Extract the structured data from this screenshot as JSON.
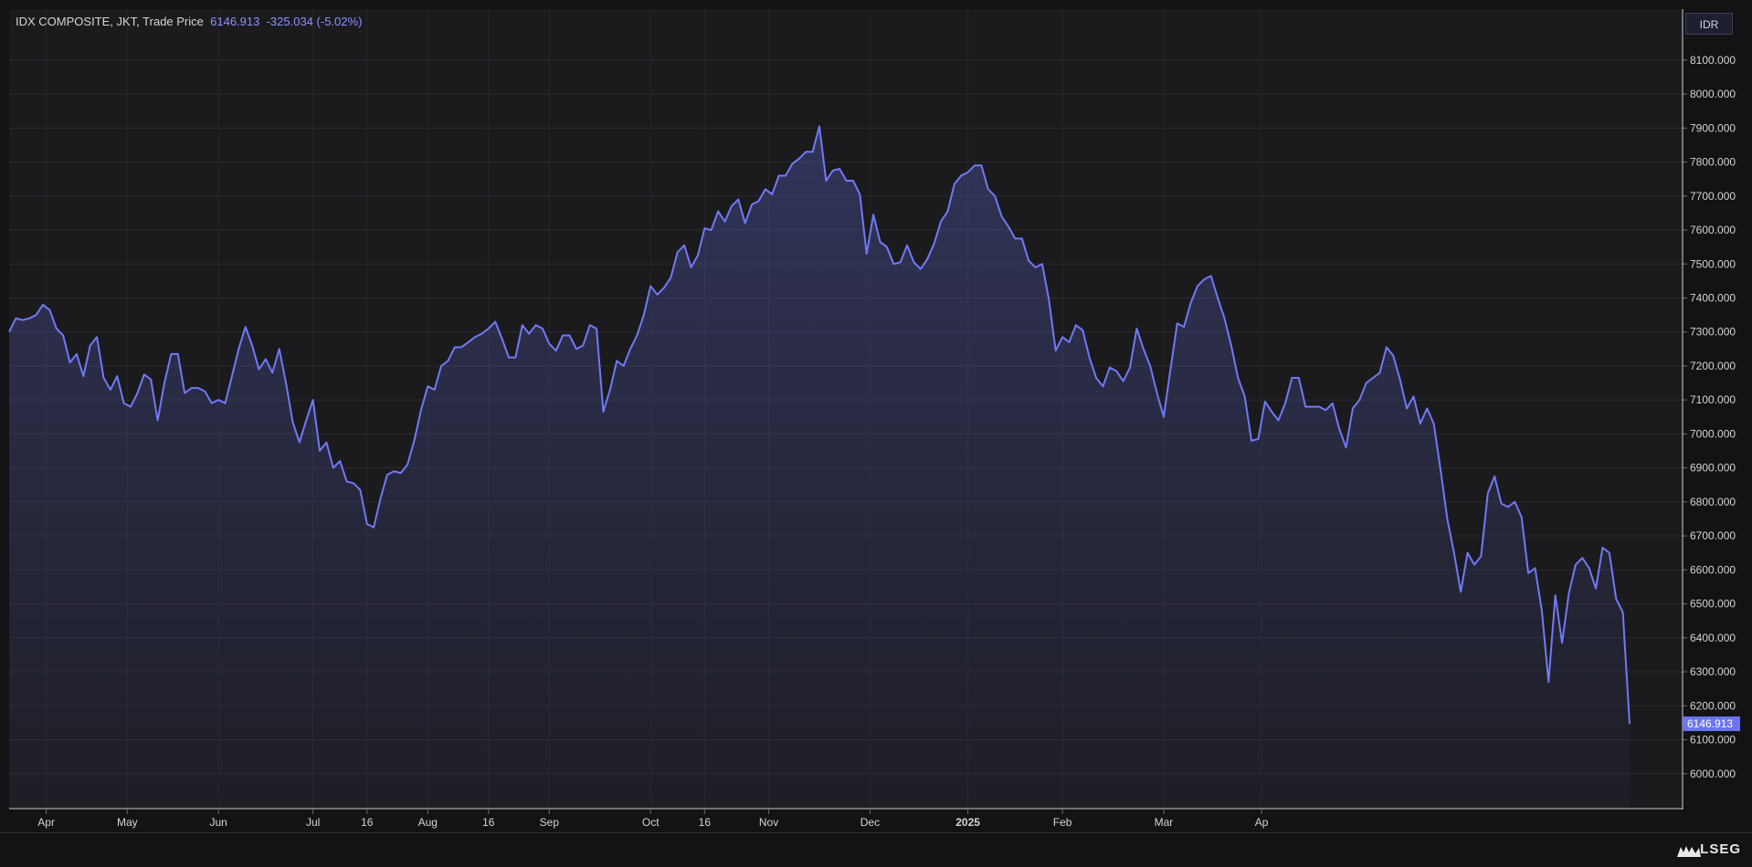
{
  "chart_data": {
    "type": "area",
    "title": "IDX COMPOSITE, JKT, Trade Price",
    "last_value": "6146.913",
    "change": "-325.034",
    "change_pct": "(-5.02%)",
    "currency": "IDR",
    "brand": "LSEG",
    "ylim": [
      5900,
      8250
    ],
    "yticks": [
      "6000.000",
      "6100.000",
      "6200.000",
      "6300.000",
      "6400.000",
      "6500.000",
      "6600.000",
      "6700.000",
      "6800.000",
      "6900.000",
      "7000.000",
      "7100.000",
      "7200.000",
      "7300.000",
      "7400.000",
      "7500.000",
      "7600.000",
      "7700.000",
      "7800.000",
      "7900.000",
      "8000.000",
      "8100.000"
    ],
    "xticks": [
      {
        "label": "Apr",
        "t": 5.5
      },
      {
        "label": "May",
        "t": 17.5
      },
      {
        "label": "Jun",
        "t": 31
      },
      {
        "label": "Jul",
        "t": 45
      },
      {
        "label": "16",
        "t": 53
      },
      {
        "label": "Aug",
        "t": 62
      },
      {
        "label": "16",
        "t": 71
      },
      {
        "label": "Sep",
        "t": 80
      },
      {
        "label": "Oct",
        "t": 95
      },
      {
        "label": "16",
        "t": 103
      },
      {
        "label": "Nov",
        "t": 112.5
      },
      {
        "label": "Dec",
        "t": 127.5
      },
      {
        "label": "2025",
        "t": 142
      },
      {
        "label": "Feb",
        "t": 156
      },
      {
        "label": "Mar",
        "t": 171
      },
      {
        "label": "Ap",
        "t": 185.5
      }
    ],
    "series": [
      {
        "values": [
          7300,
          7340,
          7335,
          7340,
          7350,
          7380,
          7365,
          7310,
          7290,
          7210,
          7235,
          7170,
          7260,
          7285,
          7165,
          7130,
          7170,
          7090,
          7080,
          7120,
          7175,
          7160,
          7040,
          7150,
          7235,
          7235,
          7120,
          7135,
          7135,
          7125,
          7090,
          7100,
          7090,
          7170,
          7250,
          7315,
          7260,
          7190,
          7220,
          7180,
          7250,
          7150,
          7035,
          6975,
          7040,
          7100,
          6950,
          6975,
          6900,
          6920,
          6860,
          6855,
          6835,
          6735,
          6725,
          6810,
          6880,
          6890,
          6885,
          6910,
          6980,
          7070,
          7140,
          7130,
          7200,
          7215,
          7255,
          7255,
          7270,
          7285,
          7295,
          7310,
          7330,
          7280,
          7225,
          7225,
          7320,
          7295,
          7320,
          7310,
          7265,
          7245,
          7290,
          7290,
          7250,
          7260,
          7320,
          7310,
          7065,
          7130,
          7215,
          7200,
          7250,
          7290,
          7350,
          7435,
          7410,
          7430,
          7460,
          7535,
          7555,
          7490,
          7525,
          7605,
          7600,
          7655,
          7625,
          7670,
          7690,
          7620,
          7675,
          7685,
          7720,
          7705,
          7760,
          7760,
          7795,
          7810,
          7830,
          7830,
          7905,
          7745,
          7775,
          7780,
          7745,
          7745,
          7705,
          7530,
          7645,
          7565,
          7550,
          7500,
          7505,
          7555,
          7505,
          7485,
          7515,
          7560,
          7625,
          7655,
          7735,
          7760,
          7770,
          7790,
          7790,
          7720,
          7700,
          7640,
          7610,
          7575,
          7575,
          7510,
          7490,
          7500,
          7395,
          7245,
          7285,
          7270,
          7320,
          7305,
          7225,
          7165,
          7140,
          7195,
          7185,
          7155,
          7195,
          7310,
          7250,
          7200,
          7120,
          7050,
          7190,
          7325,
          7315,
          7385,
          7435,
          7455,
          7465,
          7400,
          7340,
          7260,
          7165,
          7110,
          6980,
          6985,
          7095,
          7065,
          7040,
          7090,
          7165,
          7165,
          7080,
          7080,
          7080,
          7070,
          7090,
          7015,
          6960,
          7075,
          7100,
          7150,
          7165,
          7180,
          7255,
          7230,
          7160,
          7075,
          7110,
          7030,
          7075,
          7030,
          6895,
          6750,
          6650,
          6535,
          6650,
          6615,
          6640,
          6825,
          6875,
          6795,
          6785,
          6800,
          6755,
          6590,
          6605,
          6480,
          6270,
          6525,
          6385,
          6530,
          6615,
          6635,
          6605,
          6545,
          6665,
          6650,
          6515,
          6475,
          6146.913
        ]
      }
    ]
  }
}
